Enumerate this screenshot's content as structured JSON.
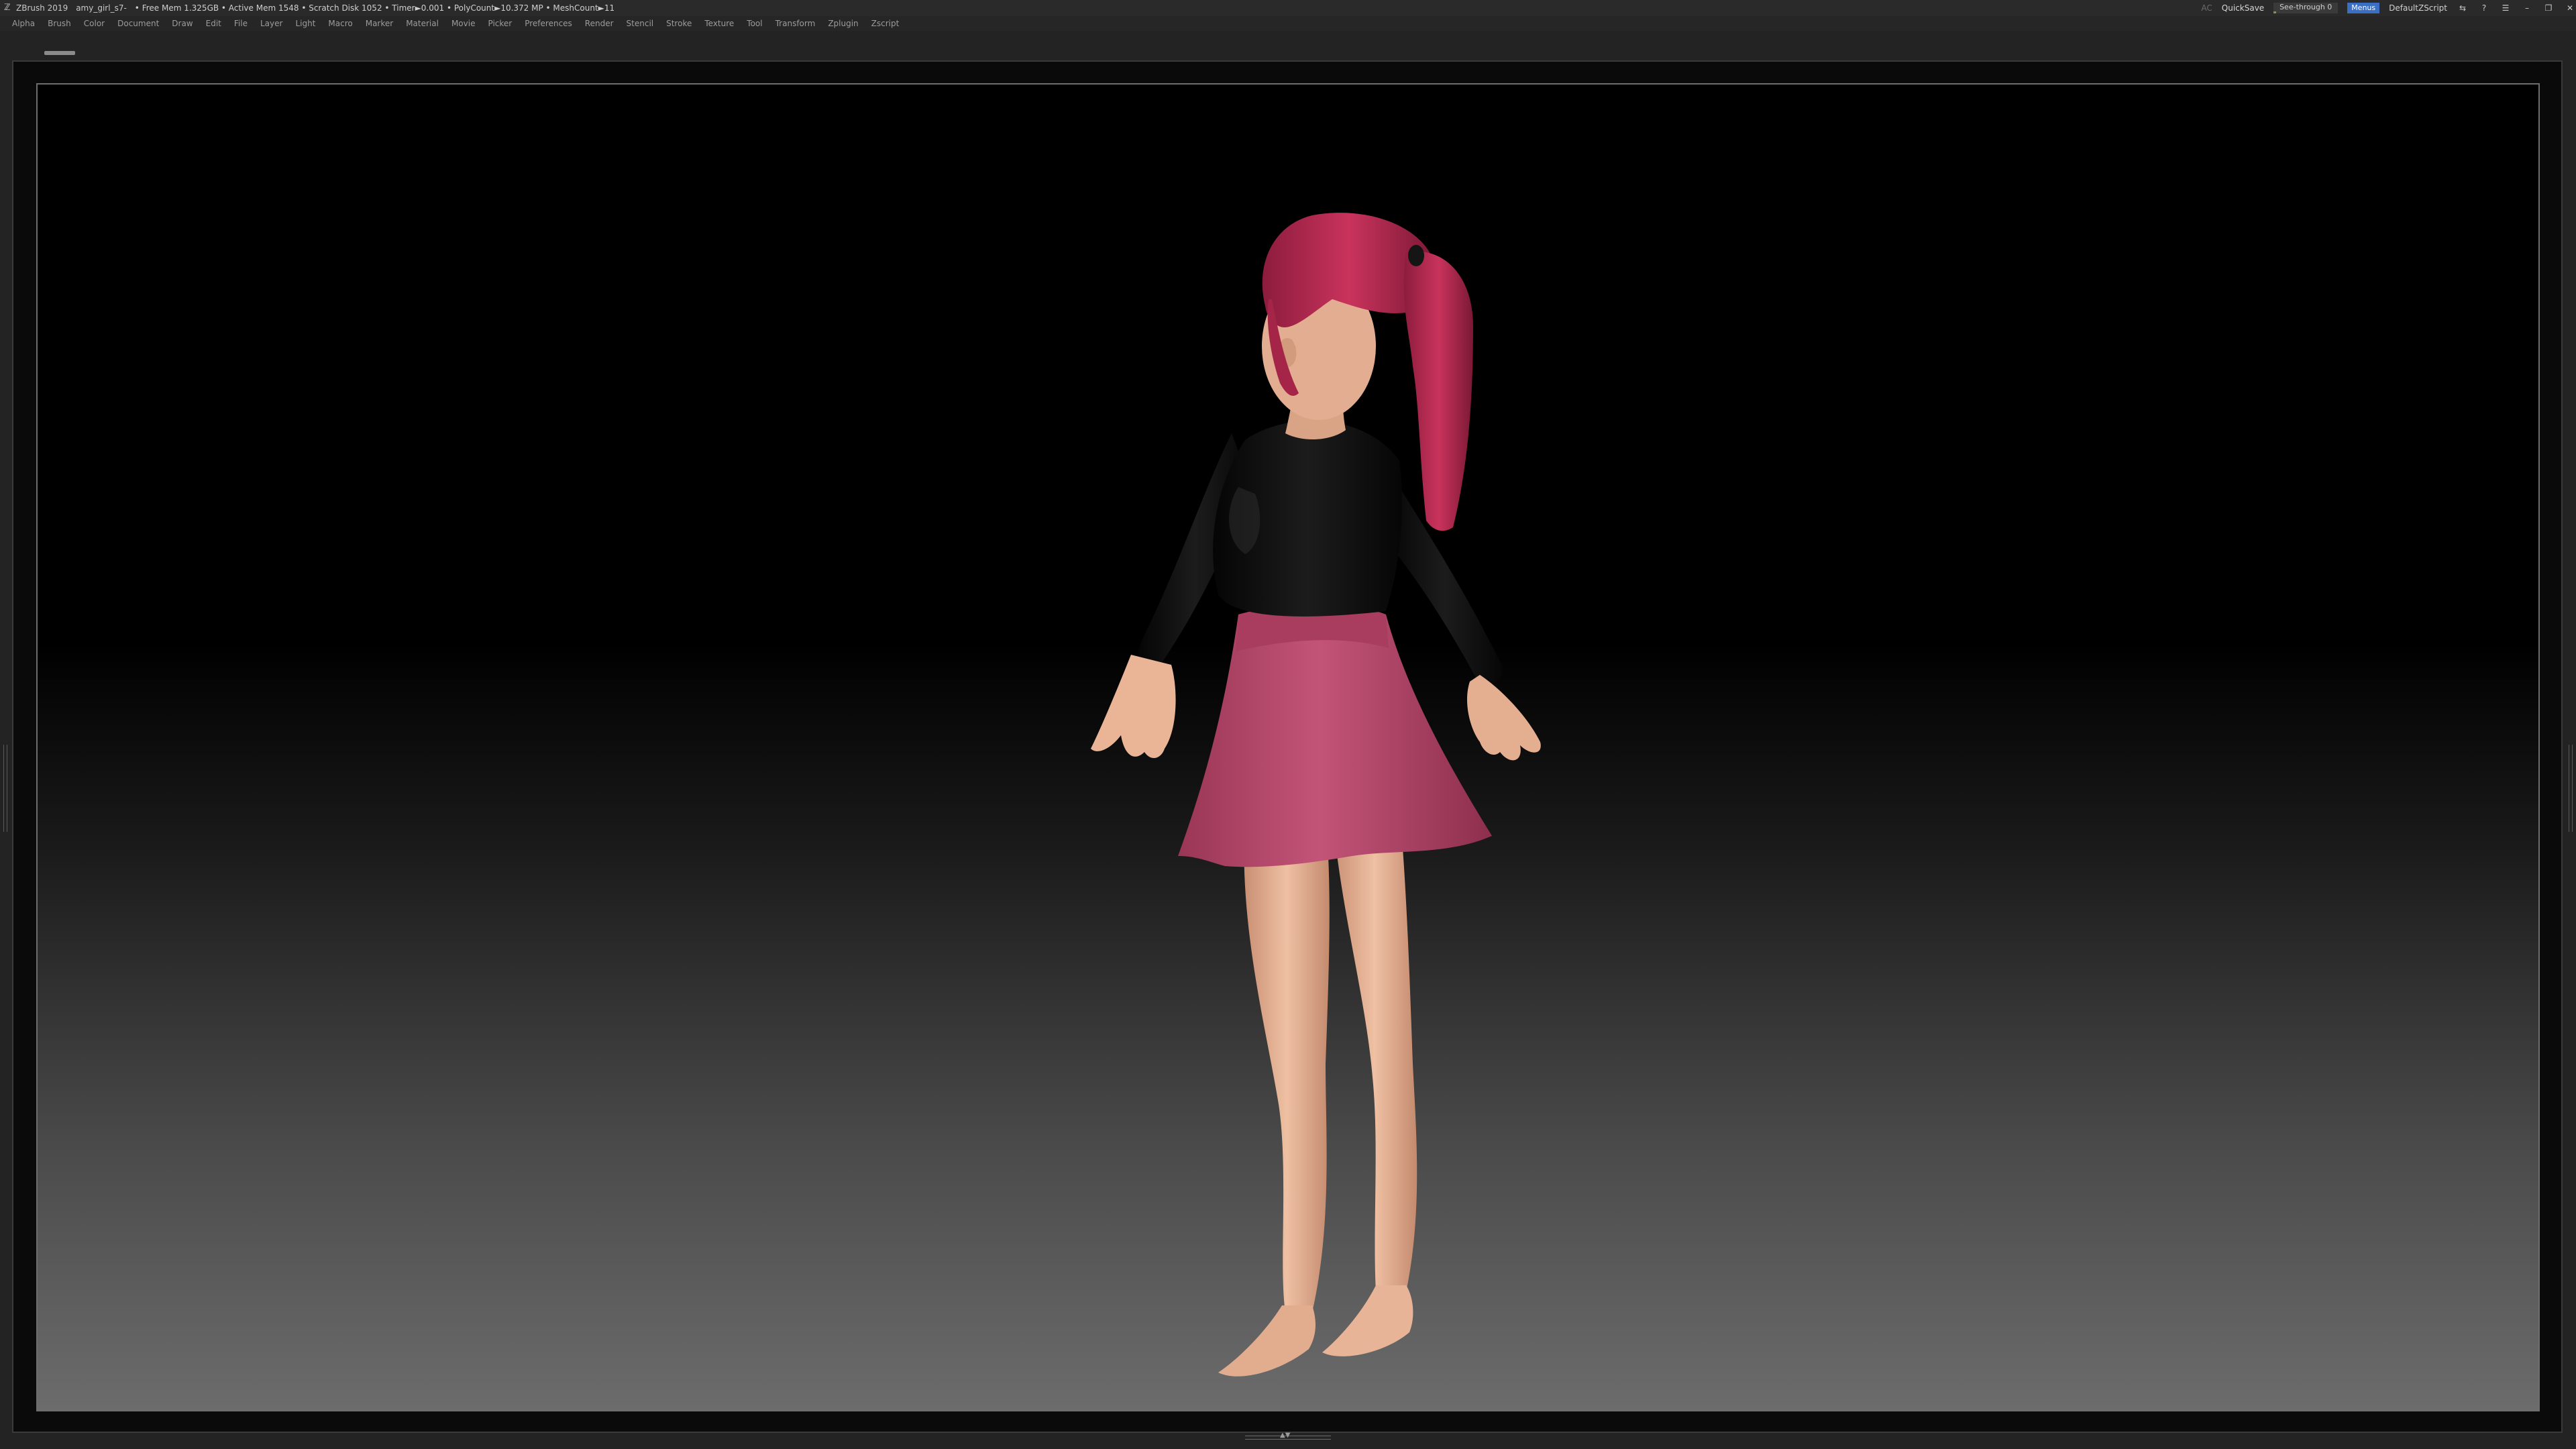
{
  "titlebar": {
    "app": "ZBrush 2019",
    "file": "amy_girl_s7-",
    "stats": "• Free Mem 1.325GB • Active Mem 1548 • Scratch Disk 1052 • Timer►0.001 • PolyCount►10.372 MP • MeshCount►11",
    "ac": "AC",
    "quicksave": "QuickSave",
    "seethrough": "See-through  0",
    "seethrough_level": 0,
    "menus": "Menus",
    "script": "DefaultZScript",
    "icons": [
      "swap-icon",
      "help-icon",
      "palette-icon",
      "minimize-icon",
      "restore-icon",
      "close-icon"
    ]
  },
  "menubar": {
    "items": [
      "Alpha",
      "Brush",
      "Color",
      "Document",
      "Draw",
      "Edit",
      "File",
      "Layer",
      "Light",
      "Macro",
      "Marker",
      "Material",
      "Movie",
      "Picker",
      "Preferences",
      "Render",
      "Stencil",
      "Stroke",
      "Texture",
      "Tool",
      "Transform",
      "Zplugin",
      "Zscript"
    ]
  },
  "colors": {
    "accent": "#3b6fc4",
    "hair": "#b0284f",
    "skirt": "#b24668",
    "shirt": "#121212",
    "skin": "#e7b597",
    "seethrough_fill": "#6fa03a"
  }
}
